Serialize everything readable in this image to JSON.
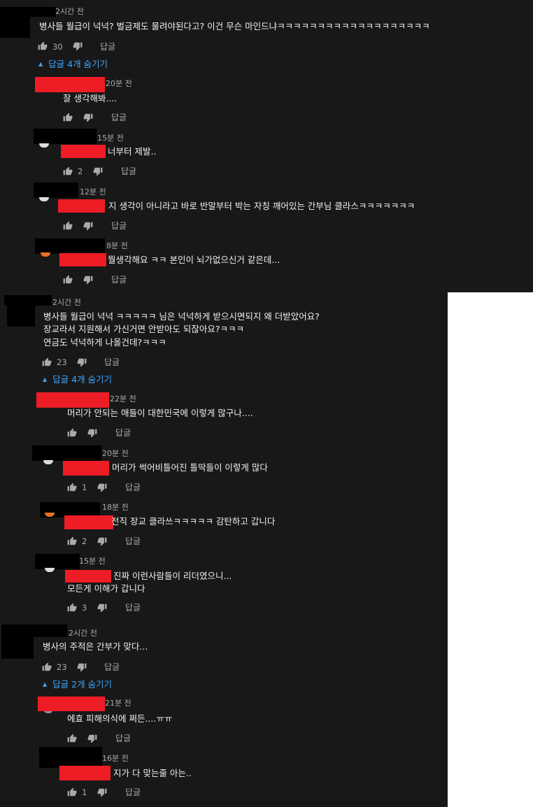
{
  "labels": {
    "reply": "답글"
  },
  "icons": {
    "like": "thumbs-up-icon",
    "dislike": "thumbs-down-icon",
    "toggle": "caret-up-icon"
  },
  "threads": [
    {
      "time": "2시간 전",
      "lines": [
        "병사들 월급이 넉넉? 벌금제도 물려야된다고? 이건 무슨 마인드냐ㅋㅋㅋㅋㅋㅋㅋㅋㅋㅋㅋㅋㅋㅋㅋㅋㅋㅋㅋ"
      ],
      "likes": "30",
      "toggle": "답글 4개 숨기기",
      "replies": [
        {
          "time": "20분 전",
          "lines": [
            "잘 생각해봐...."
          ],
          "likes": ""
        },
        {
          "time": "15분 전",
          "lines": [
            "너부터 제발.."
          ],
          "likes": "2"
        },
        {
          "time": "12분 전",
          "lines": [
            "지 생각이 아니라고 바로 반말부터 박는 자칭 깨어있는 간부님 클라스ㅋㅋㅋㅋㅋㅋㅋ"
          ],
          "likes": ""
        },
        {
          "time": "8분 전",
          "lines": [
            "뭘생각해요 ㅋㅋ 본인이 뇌가없으신거 같은데..."
          ],
          "likes": ""
        }
      ]
    },
    {
      "time": "2시간 전",
      "lines": [
        "병사들 월급이 넉넉 ㅋㅋㅋㅋㅋ 님은 넉넉하게 받으시면되지 왜 더받았어요?",
        "장교라서 지원해서 가신거면 안받아도 되잖아요?ㅋㅋㅋ",
        "연금도 넉넉하게 나올건데?ㅋㅋㅋ"
      ],
      "likes": "23",
      "toggle": "답글 4개 숨기기",
      "replies": [
        {
          "time": "22분 전",
          "lines": [
            "머리가 안되는 애들이 대한민국에 이렇게 많구나...."
          ],
          "likes": ""
        },
        {
          "time": "20분 전",
          "lines": [
            "머리가 썩어비틀어진 틀딱들이 이렇게 많다"
          ],
          "likes": "1"
        },
        {
          "time": "18분 전",
          "lines": [
            "전직 장교 클라쓰ㅋㅋㅋㅋㅋ 감탄하고 갑니다"
          ],
          "likes": "2"
        },
        {
          "time": "15분 전",
          "lines": [
            "진짜 이런사람들이 리더였으니...",
            "모든게 이해가 갑니다"
          ],
          "likes": "3"
        }
      ]
    },
    {
      "time": "2시간 전",
      "lines": [
        "병사의 주적은 간부가 맞다..."
      ],
      "likes": "23",
      "toggle": "답글 2개 숨기기",
      "replies": [
        {
          "time": "21분 전",
          "lines": [
            "에효 피해의식에 쩌든....ㅠㅠ"
          ],
          "likes": ""
        },
        {
          "time": "16분 전",
          "lines": [
            "지가 다 맞는줄 아는.."
          ],
          "likes": "1"
        }
      ]
    }
  ]
}
